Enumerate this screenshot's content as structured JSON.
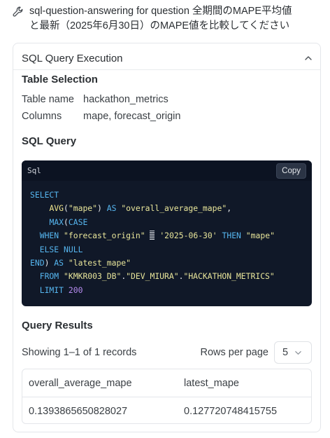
{
  "tool": {
    "icon": "wrench-icon",
    "title_line1": "sql-question-answering for question 全期間のMAPE平均値",
    "title_line2": "と最新（2025年6月30日）のMAPE値を比較してください"
  },
  "card": {
    "title": "SQL Query Execution",
    "collapse_icon": "chevron-up-icon"
  },
  "table_selection": {
    "heading": "Table Selection",
    "table_name_label": "Table name",
    "table_name_value": "hackathon_metrics",
    "columns_label": "Columns",
    "columns_value": "mape, forecast_origin"
  },
  "sql_query": {
    "heading": "SQL Query",
    "language": "Sql",
    "copy_label": "Copy",
    "lines": [
      "SELECT",
      "    AVG(\"mape\") AS \"overall_average_mape\",",
      "    MAX(CASE",
      "  WHEN \"forecast_origin\" = '2025-06-30' THEN \"mape\"",
      "  ELSE NULL",
      "END) AS \"latest_mape\"",
      "  FROM \"KMKR003_DB\".\"DEV_MIURA\".\"HACKATHON_METRICS\"",
      "  LIMIT 200"
    ]
  },
  "query_results": {
    "heading": "Query Results",
    "showing_text": "Showing 1–1 of 1 records",
    "rows_per_page_label": "Rows per page",
    "rows_per_page_value": "5",
    "columns": [
      "overall_average_mape",
      "latest_mape"
    ],
    "rows": [
      [
        "0.1393865650828027",
        "0.127720748415755"
      ]
    ]
  }
}
